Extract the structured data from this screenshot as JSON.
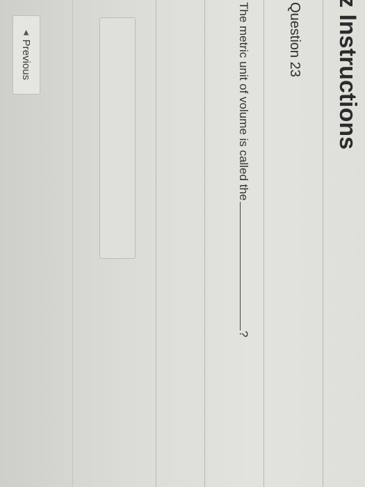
{
  "header": {
    "title": "z Instructions"
  },
  "question": {
    "label": "Question 23",
    "text": "The metric unit of volume is called the",
    "end_mark": "?"
  },
  "answer": {
    "value": ""
  },
  "navigation": {
    "previous_label": "Previous",
    "previous_icon": "triangle-left-icon"
  }
}
